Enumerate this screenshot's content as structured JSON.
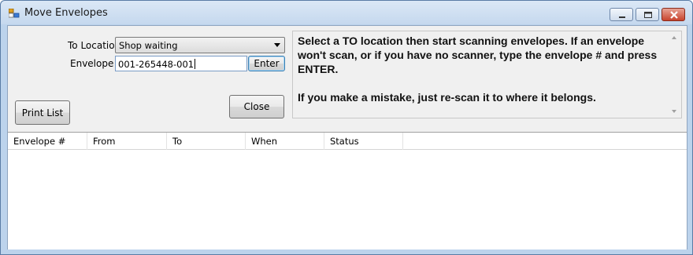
{
  "window": {
    "title": "Move Envelopes"
  },
  "form": {
    "to_location_label": "To Location",
    "to_location_value": "Shop waiting",
    "envelope_label": "Envelope #",
    "envelope_value": "001-265448-001",
    "enter_label": "Enter",
    "close_label": "Close",
    "print_list_label": "Print List"
  },
  "instructions": {
    "line1": "Select a TO location then start scanning envelopes.  If an envelope won't scan, or if you have no scanner, type the envelope # and press ENTER.",
    "line2": "If you make a mistake, just re-scan it to where it belongs."
  },
  "list": {
    "columns": [
      "Envelope #",
      "From",
      "To",
      "When",
      "Status"
    ],
    "rows": []
  },
  "icons": {
    "app": "app-form-icon",
    "minimize": "minimize-icon",
    "maximize": "maximize-icon",
    "close": "close-icon",
    "dropdown": "chevron-down-icon"
  }
}
